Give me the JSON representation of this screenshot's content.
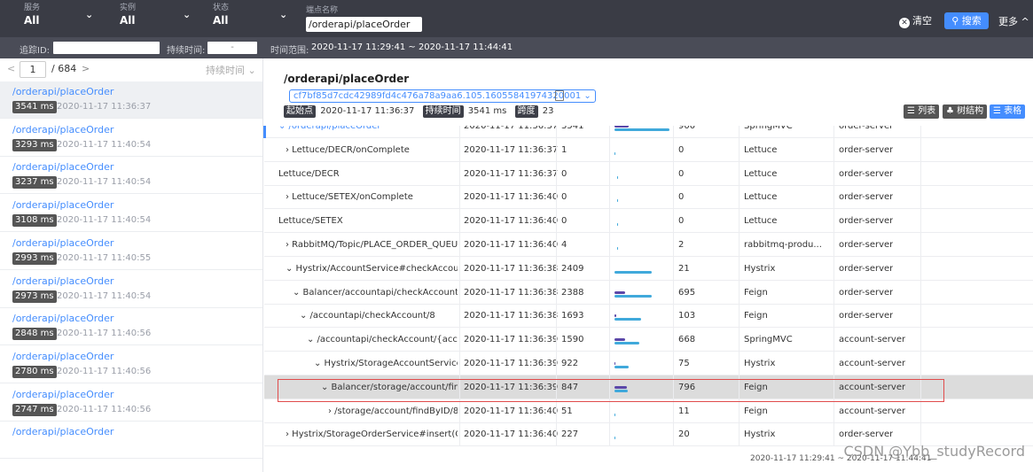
{
  "topbar": {
    "service": {
      "label": "服务",
      "value": "All"
    },
    "instance": {
      "label": "实例",
      "value": "All"
    },
    "state": {
      "label": "状态",
      "value": "All"
    },
    "endpoint": {
      "label": "端点名称",
      "value": "/orderapi/placeOrder"
    },
    "clear_label": "清空",
    "search_label": "搜索",
    "more_label": "更多"
  },
  "subbar": {
    "trace_id_label": "追踪ID:",
    "duration_label": "持续时间:",
    "dash": "-",
    "range_label": "时间范围:",
    "range_value": "2020-11-17 11:29:41 ~ 2020-11-17 11:44:41"
  },
  "pager": {
    "prev": "<",
    "page": "1",
    "total": "/ 684",
    "next": ">",
    "sort": "持续时间"
  },
  "traces": [
    {
      "name": "/orderapi/placeOrder",
      "dur": "3541 ms",
      "ts": "2020-11-17 11:36:37"
    },
    {
      "name": "/orderapi/placeOrder",
      "dur": "3293 ms",
      "ts": "2020-11-17 11:40:54"
    },
    {
      "name": "/orderapi/placeOrder",
      "dur": "3237 ms",
      "ts": "2020-11-17 11:40:54"
    },
    {
      "name": "/orderapi/placeOrder",
      "dur": "3108 ms",
      "ts": "2020-11-17 11:40:54"
    },
    {
      "name": "/orderapi/placeOrder",
      "dur": "2993 ms",
      "ts": "2020-11-17 11:40:55"
    },
    {
      "name": "/orderapi/placeOrder",
      "dur": "2973 ms",
      "ts": "2020-11-17 11:40:54"
    },
    {
      "name": "/orderapi/placeOrder",
      "dur": "2848 ms",
      "ts": "2020-11-17 11:40:56"
    },
    {
      "name": "/orderapi/placeOrder",
      "dur": "2780 ms",
      "ts": "2020-11-17 11:40:56"
    },
    {
      "name": "/orderapi/placeOrder",
      "dur": "2747 ms",
      "ts": "2020-11-17 11:40:56"
    },
    {
      "name": "/orderapi/placeOrder",
      "dur": "",
      "ts": ""
    }
  ],
  "detail": {
    "title": "/orderapi/placeOrder",
    "trace_id": "cf7bf85d7cdc42989fd4c476a78a9aa6.105.16055841974320001",
    "start_label": "起始点",
    "start_value": "2020-11-17 11:36:37",
    "duration_label": "持续时间",
    "duration_value": "3541 ms",
    "span_label": "跨度",
    "span_value": "23",
    "view_list": "列表",
    "view_tree": "树结构",
    "view_table": "表格"
  },
  "spans": [
    {
      "name": "⌄ /orderapi/placeOrder",
      "indent": 0,
      "time": "2020-11-17 11:36:37",
      "exec": "3541",
      "bar_start": 0.0,
      "bar_len": 1.0,
      "self_start": 0.0,
      "self_len": 0.26,
      "self": "900",
      "comp": "SpringMVC",
      "app": "order-server"
    },
    {
      "name": "› Lettuce/DECR/onComplete",
      "indent": 1,
      "time": "2020-11-17 11:36:37",
      "exec": "1",
      "bar_start": 0.0,
      "bar_len": 0.0,
      "self_start": 0.0,
      "self_len": 0.0,
      "self": "0",
      "comp": "Lettuce",
      "app": "order-server"
    },
    {
      "name": "Lettuce/DECR",
      "indent": 0,
      "time": "2020-11-17 11:36:37",
      "exec": "0",
      "bar_start": 0.05,
      "bar_len": 0.0,
      "self_start": 0.0,
      "self_len": 0.0,
      "self": "0",
      "comp": "Lettuce",
      "app": "order-server"
    },
    {
      "name": "› Lettuce/SETEX/onComplete",
      "indent": 1,
      "time": "2020-11-17 11:36:40",
      "exec": "0",
      "bar_start": 0.05,
      "bar_len": 0.0,
      "self_start": 0.0,
      "self_len": 0.0,
      "self": "0",
      "comp": "Lettuce",
      "app": "order-server"
    },
    {
      "name": "Lettuce/SETEX",
      "indent": 0,
      "time": "2020-11-17 11:36:40",
      "exec": "0",
      "bar_start": 0.05,
      "bar_len": 0.0,
      "self_start": 0.0,
      "self_len": 0.0,
      "self": "0",
      "comp": "Lettuce",
      "app": "order-server"
    },
    {
      "name": "› RabbitMQ/Topic/PLACE_ORDER_QUEUE_E...",
      "indent": 1,
      "time": "2020-11-17 11:36:40",
      "exec": "4",
      "bar_start": 0.05,
      "bar_len": 0.0,
      "self_start": 0.0,
      "self_len": 0.0,
      "self": "2",
      "comp": "rabbitmq-produ...",
      "app": "order-server"
    },
    {
      "name": "⌄ Hystrix/AccountService#checkAccount(Ser...",
      "indent": 1,
      "time": "2020-11-17 11:36:38",
      "exec": "2409",
      "bar_start": 0.0,
      "bar_len": 0.68,
      "self_start": 0.0,
      "self_len": 0.0,
      "self": "21",
      "comp": "Hystrix",
      "app": "order-server"
    },
    {
      "name": "⌄ Balancer/accountapi/checkAccount/(acc...",
      "indent": 2,
      "time": "2020-11-17 11:36:38",
      "exec": "2388",
      "bar_start": 0.0,
      "bar_len": 0.67,
      "self_start": 0.0,
      "self_len": 0.2,
      "self": "695",
      "comp": "Feign",
      "app": "order-server"
    },
    {
      "name": "⌄ /accountapi/checkAccount/8",
      "indent": 3,
      "time": "2020-11-17 11:36:38",
      "exec": "1693",
      "bar_start": 0.0,
      "bar_len": 0.48,
      "self_start": 0.0,
      "self_len": 0.03,
      "self": "103",
      "comp": "Feign",
      "app": "order-server"
    },
    {
      "name": "⌄ /accountapi/checkAccount/{accountId}",
      "indent": 4,
      "time": "2020-11-17 11:36:39",
      "exec": "1590",
      "bar_start": 0.0,
      "bar_len": 0.45,
      "self_start": 0.0,
      "self_len": 0.19,
      "self": "668",
      "comp": "SpringMVC",
      "app": "account-server"
    },
    {
      "name": "⌄ Hystrix/StorageAccountService#fin...",
      "indent": 5,
      "time": "2020-11-17 11:36:39",
      "exec": "922",
      "bar_start": 0.0,
      "bar_len": 0.26,
      "self_start": 0.0,
      "self_len": 0.02,
      "self": "75",
      "comp": "Hystrix",
      "app": "account-server"
    },
    {
      "name": "⌄ Balancer/storage/account/findByI...",
      "indent": 6,
      "time": "2020-11-17 11:36:39",
      "exec": "847",
      "bar_start": 0.0,
      "bar_len": 0.24,
      "self_start": 0.0,
      "self_len": 0.22,
      "self": "796",
      "comp": "Feign",
      "app": "account-server"
    },
    {
      "name": "› /storage/account/findByID/8",
      "indent": 7,
      "time": "2020-11-17 11:36:40",
      "exec": "51",
      "bar_start": 0.0,
      "bar_len": 0.0,
      "self_start": 0.0,
      "self_len": 0.0,
      "self": "11",
      "comp": "Feign",
      "app": "account-server"
    },
    {
      "name": "› Hystrix/StorageOrderService#insert(Order...",
      "indent": 1,
      "time": "2020-11-17 11:36:40",
      "exec": "227",
      "bar_start": 0.0,
      "bar_len": 0.0,
      "self_start": 0.0,
      "self_len": 0.0,
      "self": "20",
      "comp": "Hystrix",
      "app": "order-server"
    }
  ],
  "footer": {
    "ts": "2020-11-17 11:29:41 ~ 2020-11-17 11:44:41",
    "watermark": "CSDN @Ybb_studyRecord"
  },
  "colors": {
    "topbar": "#3a3c45",
    "accent": "#448dfe",
    "bar_total": "#40a9db",
    "bar_self": "#5b47a8",
    "highlight": "#e04c4c"
  }
}
